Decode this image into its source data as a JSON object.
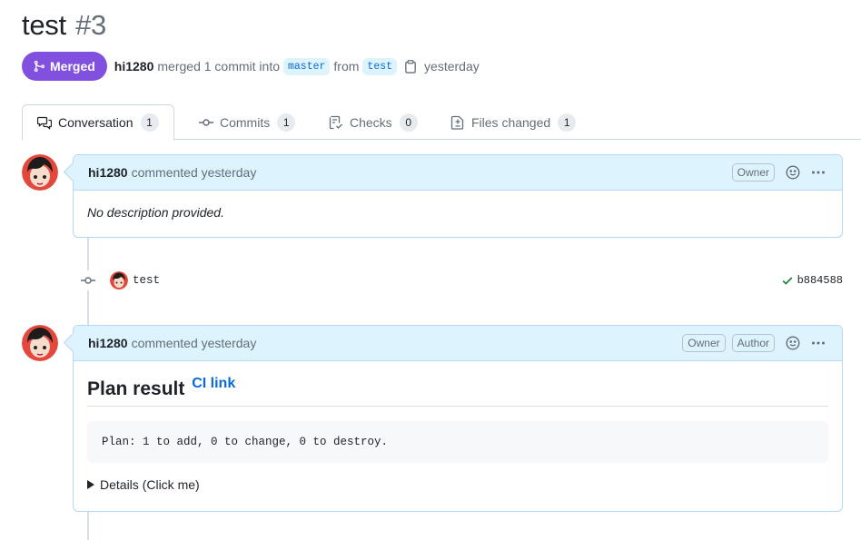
{
  "pr": {
    "title": "test",
    "number": "#3",
    "state": "Merged",
    "author": "hi1280",
    "merge_text": "merged 1 commit into",
    "base_branch": "master",
    "from_text": "from",
    "head_branch": "test",
    "time": "yesterday"
  },
  "tabs": [
    {
      "label": "Conversation",
      "count": "1",
      "icon": "comment-discussion-icon"
    },
    {
      "label": "Commits",
      "count": "1",
      "icon": "git-commit-icon"
    },
    {
      "label": "Checks",
      "count": "0",
      "icon": "checklist-icon"
    },
    {
      "label": "Files changed",
      "count": "1",
      "icon": "file-diff-icon"
    }
  ],
  "comments": [
    {
      "author": "hi1280",
      "action": "commented yesterday",
      "labels": [
        "Owner"
      ],
      "body": "No description provided."
    },
    {
      "author": "hi1280",
      "action": "commented yesterday",
      "labels": [
        "Owner",
        "Author"
      ],
      "heading": "Plan result",
      "heading_link": "CI link",
      "code": "Plan: 1 to add, 0 to change, 0 to destroy.",
      "details_summary": "Details (Click me)"
    }
  ],
  "commit": {
    "message": "test",
    "sha": "b884588",
    "status": "success"
  },
  "colors": {
    "merged": "#8250df",
    "link": "#0969da",
    "header_bg": "#ddf4ff",
    "success": "#1a7f37"
  }
}
